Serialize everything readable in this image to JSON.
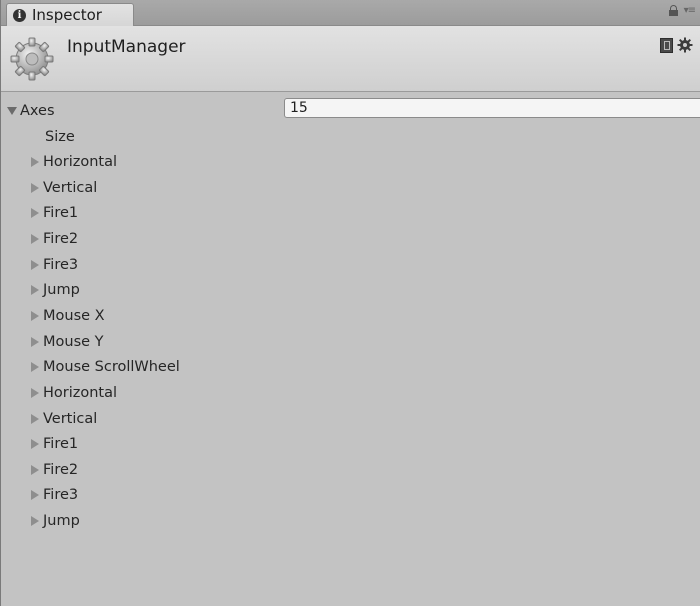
{
  "tab": {
    "title": "Inspector",
    "info_icon": "info-icon",
    "lock_icon": "lock-icon",
    "menu_icon": "panel-menu-icon"
  },
  "header": {
    "title": "InputManager",
    "component_icon": "gear-icon",
    "help_icon": "help-book-icon",
    "settings_icon": "gear-icon"
  },
  "axes": {
    "label": "Axes",
    "expanded": true,
    "size_label": "Size",
    "size_value": "15",
    "items": [
      {
        "label": "Horizontal"
      },
      {
        "label": "Vertical"
      },
      {
        "label": "Fire1"
      },
      {
        "label": "Fire2"
      },
      {
        "label": "Fire3"
      },
      {
        "label": "Jump"
      },
      {
        "label": "Mouse X"
      },
      {
        "label": "Mouse Y"
      },
      {
        "label": "Mouse ScrollWheel"
      },
      {
        "label": "Horizontal"
      },
      {
        "label": "Vertical"
      },
      {
        "label": "Fire1"
      },
      {
        "label": "Fire2"
      },
      {
        "label": "Fire3"
      },
      {
        "label": "Jump"
      }
    ]
  }
}
